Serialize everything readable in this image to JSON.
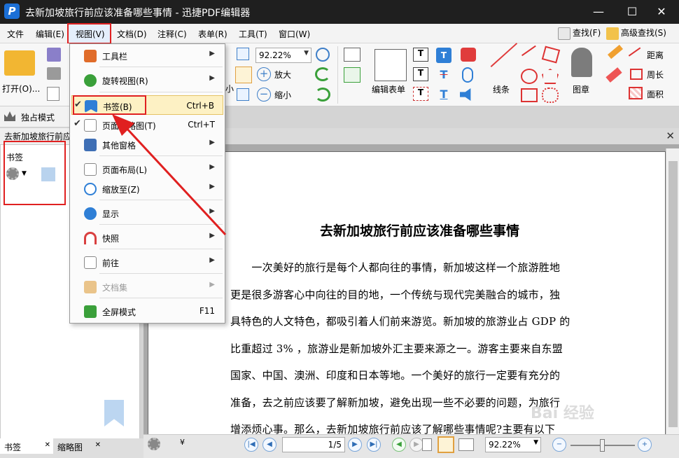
{
  "window": {
    "logo": "P",
    "title": "去新加坡旅行前应该准备哪些事情 - 迅捷PDF编辑器",
    "minimize": "—",
    "maximize": "☐",
    "close": "✕"
  },
  "menubar": {
    "items": [
      "文件",
      "编辑(E)",
      "视图(V)",
      "文档(D)",
      "注释(C)",
      "表单(R)",
      "工具(T)",
      "窗口(W)"
    ],
    "find": "查找(F)",
    "advanced_find": "高级查找(S)"
  },
  "ribbon": {
    "open": "打开(O)...",
    "zoom_value": "92.22%",
    "zoom_in": "放大",
    "zoom_out": "缩小",
    "zoom_in_partial": "小",
    "edit_form": "编辑表单",
    "line": "线条",
    "stamp": "图章",
    "distance": "距离",
    "perimeter": "周长",
    "area": "面积"
  },
  "modebar": {
    "exclusive_mode": "独占模式"
  },
  "tabs": {
    "doc_tab": "去新加坡旅行前应该准备哪些事情"
  },
  "left_panel": {
    "title": "书签",
    "bottom_tab_bookmarks": "书签",
    "bottom_tab_thumbnails": "缩略图",
    "close": "✕"
  },
  "view_menu": {
    "items": [
      {
        "label": "工具栏",
        "shortcut": "",
        "submenu": true,
        "checked": false,
        "disabled": false,
        "active": false,
        "icon_color": "#e06c2a"
      },
      {
        "label": "旋转视图(R)",
        "shortcut": "",
        "submenu": true,
        "checked": false,
        "disabled": false,
        "active": false,
        "icon_color": "#3aa03a"
      },
      {
        "label": "书签(B)",
        "shortcut": "Ctrl+B",
        "submenu": false,
        "checked": true,
        "disabled": false,
        "active": true,
        "icon_color": "#2f7fd6"
      },
      {
        "label": "页面缩略图(T)",
        "shortcut": "Ctrl+T",
        "submenu": false,
        "checked": true,
        "disabled": false,
        "active": false,
        "icon_color": "#8a8a8a"
      },
      {
        "label": "其他窗格",
        "shortcut": "",
        "submenu": true,
        "checked": false,
        "disabled": false,
        "active": false,
        "icon_color": "#3f6fb5"
      },
      {
        "label": "页面布局(L)",
        "shortcut": "",
        "submenu": true,
        "checked": false,
        "disabled": false,
        "active": false,
        "icon_color": "#8a8a8a"
      },
      {
        "label": "缩放至(Z)",
        "shortcut": "",
        "submenu": true,
        "checked": false,
        "disabled": false,
        "active": false,
        "icon_color": "#2f7fd6"
      },
      {
        "label": "显示",
        "shortcut": "",
        "submenu": true,
        "checked": false,
        "disabled": false,
        "active": false,
        "icon_color": "#2f7fd6"
      },
      {
        "label": "快照",
        "shortcut": "",
        "submenu": true,
        "checked": false,
        "disabled": false,
        "active": false,
        "icon_color": "#d94040"
      },
      {
        "label": "前往",
        "shortcut": "",
        "submenu": true,
        "checked": false,
        "disabled": false,
        "active": false,
        "icon_color": "#3aa03a"
      },
      {
        "label": "文档集",
        "shortcut": "",
        "submenu": true,
        "checked": false,
        "disabled": true,
        "active": false,
        "icon_color": "#e0a040"
      },
      {
        "label": "全屏模式",
        "shortcut": "F11",
        "submenu": false,
        "checked": false,
        "disabled": false,
        "active": false,
        "icon_color": "#3aa03a"
      }
    ]
  },
  "document": {
    "title": "去新加坡旅行前应该准备哪些事情",
    "lines": [
      "　　一次美好的旅行是每个人都向往的事情，新加坡这样一个旅游胜地",
      "更是很多游客心中向往的目的地，一个传统与现代完美融合的城市，独",
      "具特色的人文特色，都吸引着人们前来游览。新加坡的旅游业占 GDP 的",
      "比重超过 3% ，旅游业是新加坡外汇主要来源之一。游客主要来自东盟",
      "国家、中国、澳洲、印度和日本等地。一个美好的旅行一定要有充分的",
      "准备，去之前应该要了解新加坡，避免出现一些不必要的问题，为旅行",
      "增添烦心事。那么，去新加坡旅行前应该了解哪些事情呢?主要有以下"
    ]
  },
  "statusbar": {
    "page_current": "1",
    "page_total": "/5",
    "zoom": "92.22%"
  },
  "watermark": "Bai 经验",
  "colors": {
    "accent": "#e02020",
    "title_bg": "#1f1f1f",
    "brand": "#1b6fd6"
  }
}
